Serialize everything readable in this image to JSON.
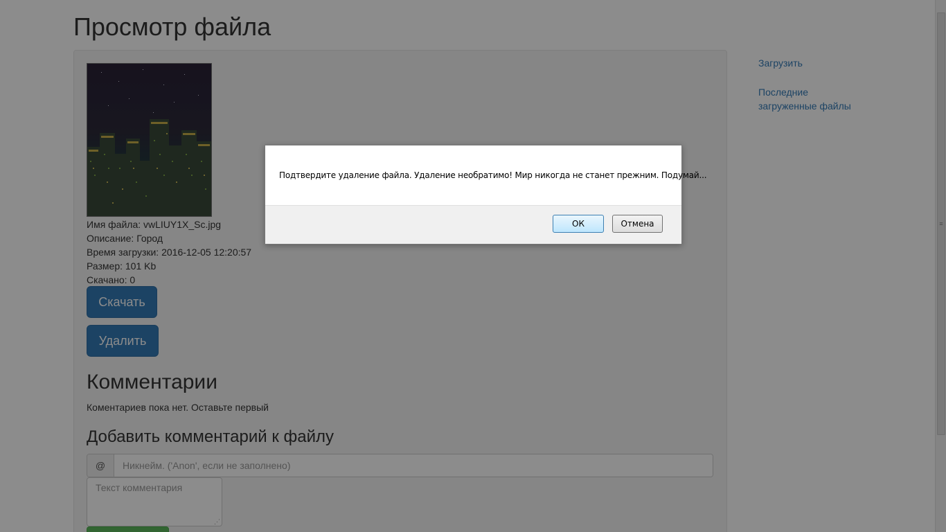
{
  "page": {
    "title": "Просмотр файла"
  },
  "file": {
    "name_line": "Имя файла: vwLIUY1X_Sc.jpg",
    "description_line": "Описание: Город",
    "upload_time_line": "Время загрузки: 2016-12-05 12:20:57",
    "size_line": "Размер: 101 Kb",
    "downloads_line": "Скачано: 0"
  },
  "actions": {
    "download_label": "Скачать",
    "delete_label": "Удалить"
  },
  "comments": {
    "heading": "Комментарии",
    "empty_text": "Коментариев пока нет. Оставьте первый"
  },
  "add_comment": {
    "heading": "Добавить комментарий к файлу",
    "at_symbol": "@",
    "nickname_placeholder": "Никнейм. ('Anon', если не заполнено)",
    "text_placeholder": "Текст комментария"
  },
  "sidebar": {
    "upload_link": "Загрузить",
    "recent_link": "Последние загруженные файлы"
  },
  "dialog": {
    "message": "Подтвердите удаление файла. Удаление необратимо! Мир никогда не станет прежним. Подумай...",
    "ok_label": "ОК",
    "cancel_label": "Отмена"
  },
  "icons": {
    "thumbnail": "city-night-image",
    "resize": "resize-grip-icon",
    "scroll_grip": "scroll-grip-icon"
  },
  "colors": {
    "link": "#337ab7",
    "primary_button": "#337ab7",
    "success_button": "#5cb85c"
  }
}
